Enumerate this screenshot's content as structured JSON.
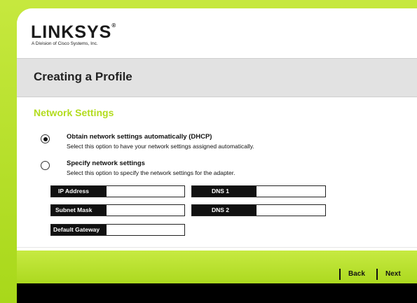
{
  "brand": {
    "logo_text": "LINKSYS",
    "logo_mark": "®",
    "tagline": "A Division of Cisco Systems, Inc."
  },
  "page": {
    "title": "Creating a Profile"
  },
  "section": {
    "title": "Network Settings"
  },
  "options": [
    {
      "title": "Obtain network settings automatically (DHCP)",
      "description": "Select this option to have your network settings assigned automatically.",
      "selected": true
    },
    {
      "title": "Specify network settings",
      "description": "Select this option to specify the network settings for the adapter.",
      "selected": false
    }
  ],
  "fields": {
    "ip_address": {
      "label": "IP Address",
      "value": ""
    },
    "subnet_mask": {
      "label": "Subnet Mask",
      "value": ""
    },
    "default_gateway": {
      "label": "Default Gateway",
      "value": ""
    },
    "dns1": {
      "label": "DNS 1",
      "value": ""
    },
    "dns2": {
      "label": "DNS 2",
      "value": ""
    }
  },
  "nav": {
    "back_label": "Back",
    "next_label": "Next"
  },
  "colors": {
    "brand_green": "#b3dc1e",
    "label_black": "#111111"
  }
}
